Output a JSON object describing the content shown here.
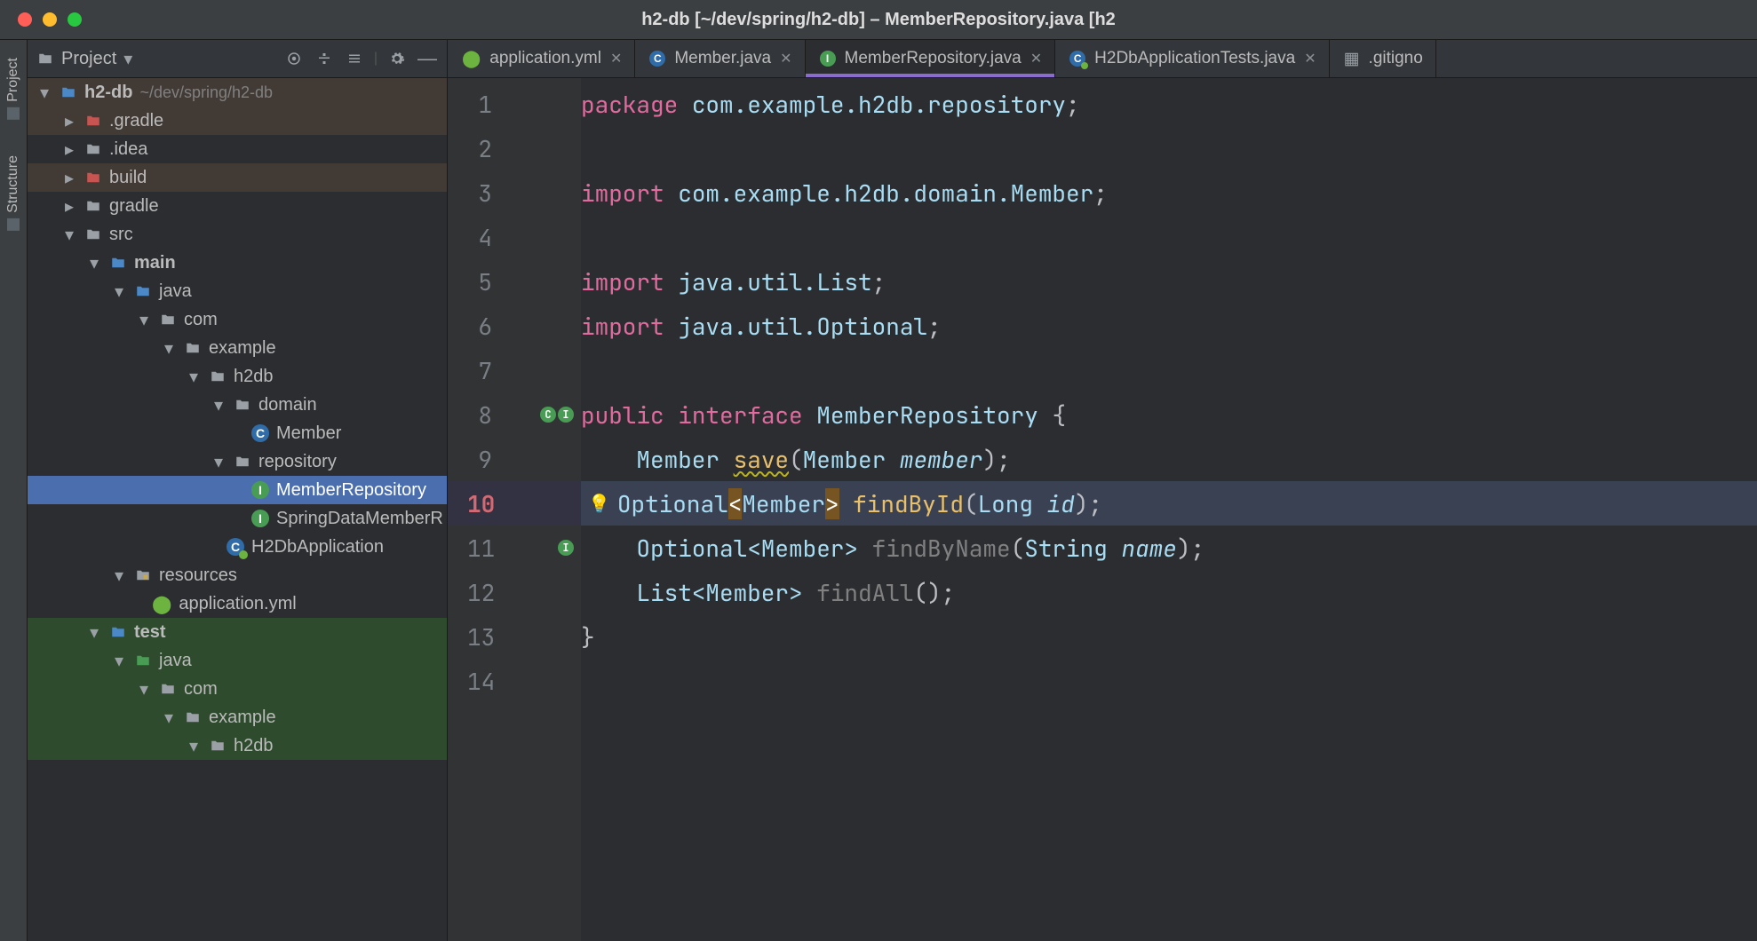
{
  "window": {
    "title": "h2-db [~/dev/spring/h2-db] – MemberRepository.java [h2"
  },
  "left_tools": {
    "project": "Project",
    "structure": "Structure"
  },
  "project_panel": {
    "title": "Project",
    "root": {
      "name": "h2-db",
      "path": "~/dev/spring/h2-db"
    },
    "items": {
      "gradle_dot": ".gradle",
      "idea": ".idea",
      "build": "build",
      "gradle": "gradle",
      "src": "src",
      "main": "main",
      "java": "java",
      "com": "com",
      "example": "example",
      "h2db": "h2db",
      "domain": "domain",
      "member": "Member",
      "repository": "repository",
      "member_repo": "MemberRepository",
      "spring_data_repo": "SpringDataMemberR",
      "app": "H2DbApplication",
      "resources": "resources",
      "app_yml": "application.yml",
      "test": "test",
      "test_java": "java",
      "test_com": "com",
      "test_example": "example",
      "test_h2db": "h2db"
    }
  },
  "tabs": [
    {
      "icon": "spring",
      "label": "application.yml"
    },
    {
      "icon": "class",
      "label": "Member.java"
    },
    {
      "icon": "iface",
      "label": "MemberRepository.java",
      "active": true
    },
    {
      "icon": "class",
      "label": "H2DbApplicationTests.java"
    },
    {
      "icon": "file",
      "label": ".gitignore",
      "truncated": ".gitigno"
    }
  ],
  "code": {
    "lines": [
      {
        "n": 1,
        "raw": "package com.example.h2db.repository;"
      },
      {
        "n": 2,
        "raw": ""
      },
      {
        "n": 3,
        "raw": "import com.example.h2db.domain.Member;"
      },
      {
        "n": 4,
        "raw": ""
      },
      {
        "n": 5,
        "raw": "import java.util.List;"
      },
      {
        "n": 6,
        "raw": "import java.util.Optional;"
      },
      {
        "n": 7,
        "raw": ""
      },
      {
        "n": 8,
        "raw": "public interface MemberRepository {",
        "gutter_icons": [
          "impl",
          "impl-down"
        ]
      },
      {
        "n": 9,
        "raw": "    Member save(Member member);"
      },
      {
        "n": 10,
        "raw": "    Optional<Member> findById(Long id);",
        "current": true,
        "bulb": true
      },
      {
        "n": 11,
        "raw": "    Optional<Member> findByName(String name);",
        "gutter_icons": [
          "impl-down"
        ]
      },
      {
        "n": 12,
        "raw": "    List<Member> findAll();"
      },
      {
        "n": 13,
        "raw": "}"
      },
      {
        "n": 14,
        "raw": ""
      }
    ]
  }
}
